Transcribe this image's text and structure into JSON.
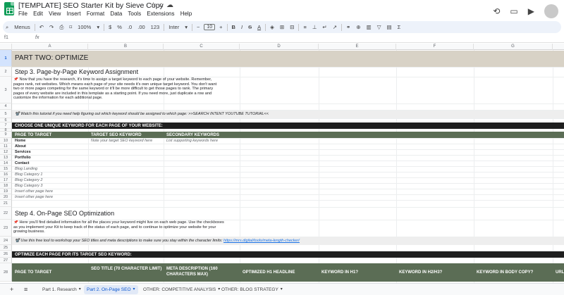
{
  "app": {
    "doc_title": "[TEMPLATE] SEO Starter Kit by Sieve Copy",
    "menu": [
      "File",
      "Edit",
      "View",
      "Insert",
      "Format",
      "Data",
      "Tools",
      "Extensions",
      "Help"
    ]
  },
  "toolbar": {
    "menus_label": "Menus",
    "zoom": "100%",
    "currency": "$",
    "percent": "%",
    "dec_decrease": ".0",
    "dec_increase": ".00",
    "number_format": "123",
    "font": "Inter",
    "font_size": "10",
    "bold": "B",
    "italic": "I",
    "strike": "S",
    "text_color": "A"
  },
  "formula_bar": {
    "cell_ref": "f1",
    "fx": "fx"
  },
  "columns": [
    "A",
    "B",
    "C",
    "D",
    "E",
    "F",
    "G"
  ],
  "rows": [
    "1",
    "2",
    "3",
    "4",
    "5",
    "6",
    "7",
    "8",
    "9",
    "10",
    "11",
    "12",
    "13",
    "14",
    "15",
    "16",
    "17",
    "18",
    "19",
    "20",
    "21",
    "22",
    "23",
    "24",
    "25",
    "26",
    "27",
    "28"
  ],
  "sheet": {
    "part_title": "PART TWO: OPTIMIZE",
    "step3_title": "Step 3. Page-by-Page Keyword Assignment",
    "step3_text": "📌 Now that you have the research, it's time to assign a target keyword to each page of your website. Remember, pages rank, not websites. Which means each page of your site needs it's own unique target keyword. You don't want two or more pages competing for the same keyword or it'll be more difficult to get those pages to rank. The primary pages of every website are included in this template as a starting point. If you need more, just duplicate a row and customize the information for each additional page.",
    "tutorial_text": "📽️ Watch this tutorial if you need help figuring out which keyword should be assigned to which page: >>SEARCH INTENT YOUTUBE TUTORIAL<<",
    "choose_header": "CHOOSE ONE UNIQUE KEYWORD FOR EACH PAGE OF YOUR WEBSITE:",
    "table1_headers": [
      "PAGE TO TARGET",
      "TARGET SEO KEYWORD",
      "SECONDARY KEYWORDS"
    ],
    "table1_placeholders": [
      "Note your target SEO keyword here",
      "List supporting keywords here"
    ],
    "pages_bold": [
      "Home",
      "About",
      "Services",
      "Portfolio",
      "Contact"
    ],
    "pages_italic": [
      "Blog Landing",
      "Blog Category 1",
      "Blog Category 2",
      "Blog Category 3",
      "Insert other page here",
      "Insert other page here"
    ],
    "step4_title": "Step 4. On-Page SEO Optimization",
    "step4_text": "📌 Here you'll find detailed information for all the places your keyword might live on each web page. Use the checkboxes as you implement your Kit to keep track of the status of each page, and to continue to optimize your website for your growing business.",
    "tool_text": "📽️ Use this free tool to workshop your SEO titles and meta descriptions to make sure you stay within the character limits:",
    "tool_link": "https://mrs.digital/tools/meta-length-checker/",
    "optimize_header": "OPTIMIZE EACH PAGE FOR ITS TARGET SEO KEYWORD:",
    "table2_headers": [
      "PAGE TO TARGET",
      "SEO TITLE (70 CHARACTER LIMIT)",
      "META DESCRIPTION (160 CHARACTERS MAX)",
      "OPTIMIZED H1 HEADLINE",
      "KEYWORD IN H1?",
      "KEYWORD IN H2/H3?",
      "KEYWORD IN BODY COPY?",
      "URL"
    ]
  },
  "tabs": [
    {
      "label": "Part 1. Research",
      "active": false
    },
    {
      "label": "Part 2. On-Page SEO",
      "active": true
    },
    {
      "label": "OTHER: COMPETITIVE ANALYSIS",
      "active": false
    },
    {
      "label": "OTHER: BLOG STRATEGY",
      "active": false
    }
  ],
  "icons": {
    "star": "star-icon",
    "move": "move-to-folder-icon",
    "cloud": "cloud-saved-icon",
    "history": "history-icon",
    "comment": "comment-icon",
    "meet": "video-call-icon"
  },
  "colors": {
    "tan_band": "#d8d2c6",
    "dark_band": "#1f1f1f",
    "green_band": "#5b6d55",
    "active_tab": "#0b57d0"
  }
}
